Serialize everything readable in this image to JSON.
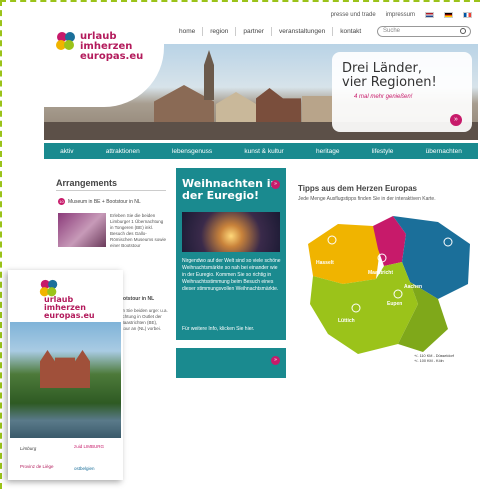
{
  "utility": {
    "press": "presse und trade",
    "impressum": "impressum"
  },
  "nav": {
    "items": [
      "home",
      "region",
      "partner",
      "veranstaltungen",
      "kontakt"
    ],
    "search_placeholder": "Suche"
  },
  "logo": {
    "line1": "urlaub",
    "line2": "imherzen",
    "line3": "europas.eu"
  },
  "hero": {
    "title_line1": "Drei Länder,",
    "title_line2": "vier Regionen!",
    "subtitle": "4 mal mehr genießen!"
  },
  "teal_nav": [
    "aktiv",
    "attraktionen",
    "lebensgenuss",
    "kunst & kultur",
    "heritage",
    "lifestyle",
    "übernachten"
  ],
  "arrangements": {
    "title": "Arrangements",
    "item1_title": "Museum in BE + Bootstour in NL",
    "item1_num": "10",
    "item1_text": "Erleben Sie die beiden Limburge! 1 Übernachtung in Tongeren (BE) inkl. Besuch des Gallo-Römischen Museums sowie einer Bootstour",
    "item1_text2": "an Maastricht vorbei, € 65 p.P.",
    "item2_title": "ootstour in NL",
    "item2_text": "en Sie beiden urge: u.a. achtung in Outlet der Maastrichten (BE), stour an (NL) vorbei."
  },
  "xmas": {
    "title_line1": "Weihnachten in",
    "title_line2": "der Euregio!",
    "badge": "»",
    "text": "Nirgendwo auf der Welt sind so viele schöne Weihnachtsmärkte so nah bei einander wie in der Euregio. Kommen Sie so richtig in Weihnachtsstimmung beim Besuch eines dieser stimmungsvollen Weihnachtsmärkte.",
    "more": "Für weitere Info, klicken Sie hier."
  },
  "tipps": {
    "title": "Tipps aus dem Herzen Europas",
    "subtitle": "Jede Menge Ausflugstipps finden Sie in der interaktiven Karte."
  },
  "map": {
    "labels": [
      "Hasselt",
      "Maastricht",
      "Aachen",
      "Lüttich",
      "Eupen"
    ],
    "legend_line1": "+/- 110 KM - Düsseldorf",
    "legend_line2": "+/- 100 KM - Köln"
  },
  "brochure": {
    "logo_line1": "urlaub",
    "logo_line2": "imherzen",
    "logo_line3": "europas.eu",
    "partners": [
      "Limburg",
      "zuid LIMBURG",
      "Provinz de Liège",
      "ostbelgien"
    ]
  },
  "colors": {
    "teal": "#1a8a8f",
    "magenta": "#c71a6a",
    "green": "#9bc31a",
    "blue": "#1b6f9a"
  }
}
